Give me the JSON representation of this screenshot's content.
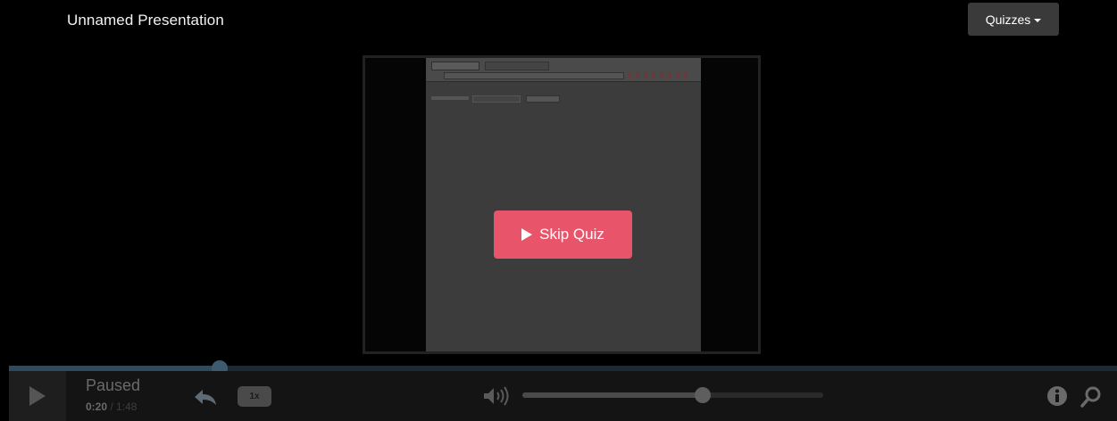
{
  "header": {
    "title": "Unnamed Presentation",
    "quizzes_label": "Quizzes"
  },
  "overlay": {
    "skip_quiz_label": "Skip Quiz",
    "accent_color": "#e8546a"
  },
  "controls": {
    "status": "Paused",
    "current_time": "0:20",
    "time_separator": " / ",
    "total_time": "1:48",
    "speed_label": "1x",
    "progress_fraction": 0.19,
    "volume_fraction": 0.6
  },
  "icons": [
    "play-icon",
    "rewind-icon",
    "volume-icon",
    "info-icon",
    "search-icon",
    "caret-down-icon"
  ]
}
